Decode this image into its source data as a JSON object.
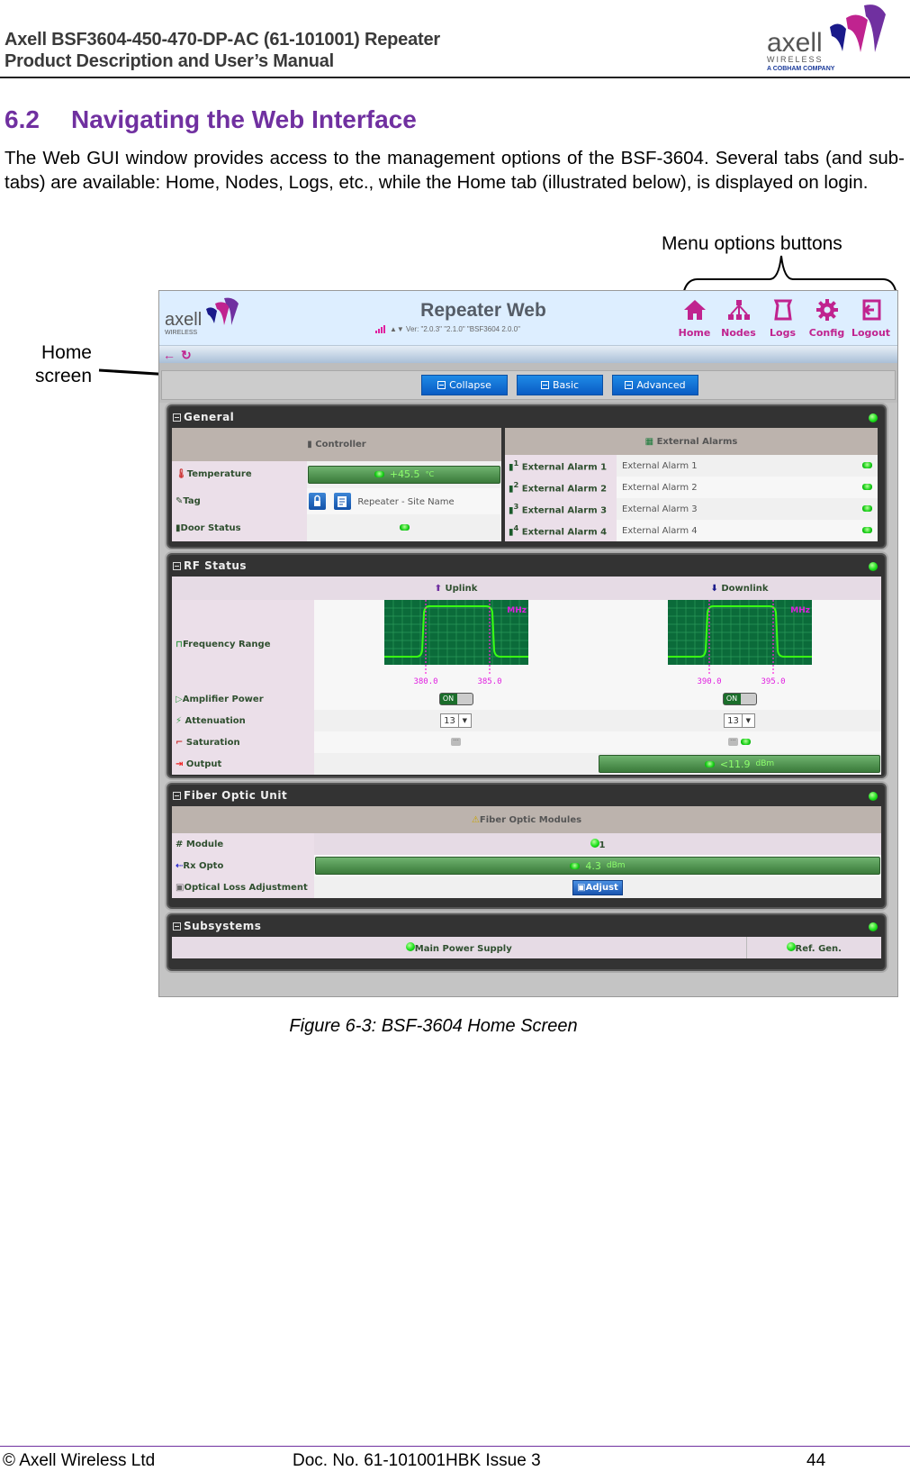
{
  "doc_header": {
    "title_line1": "Axell BSF3604-450-470-DP-AC (61-101001) Repeater",
    "title_line2": "Product Description and User’s Manual",
    "logo_brand": "axell",
    "logo_sub": "WIRELESS",
    "logo_company": "A COBHAM COMPANY"
  },
  "section": {
    "number": "6.2",
    "title": "Navigating the Web Interface",
    "intro": "The Web GUI window provides access to the management options of the BSF-3604. Several tabs (and sub-tabs) are available: Home, Nodes, Logs, etc., while the Home tab (illustrated below), is displayed on login."
  },
  "annotations": {
    "menu_options": "Menu options buttons",
    "home_line1": "Home",
    "home_line2": "screen"
  },
  "app": {
    "logo_brand": "axell",
    "logo_sub": "WIRELESS",
    "title": "Repeater Web",
    "version": "▲▼ Ver: \"2.0.3\" \"2.1.0\" \"BSF3604 2.0.0\"",
    "menu": [
      {
        "label": "Home",
        "icon": "home-icon"
      },
      {
        "label": "Nodes",
        "icon": "nodes-icon"
      },
      {
        "label": "Logs",
        "icon": "logs-icon"
      },
      {
        "label": "Config",
        "icon": "gear-icon"
      },
      {
        "label": "Logout",
        "icon": "logout-icon"
      }
    ],
    "nav": {
      "back_icon": "←",
      "refresh_icon": "↻"
    },
    "mode_buttons": [
      "Collapse",
      "Basic",
      "Advanced"
    ],
    "accent_color": "#c0238f",
    "general": {
      "title": "General",
      "controller_header": "Controller",
      "rows": [
        {
          "label": "Temperature",
          "value": "+45.5",
          "unit": "°C"
        },
        {
          "label": "Tag",
          "value": "Repeater - Site Name"
        },
        {
          "label": "Door Status",
          "value": ""
        }
      ],
      "alarms_header": "External Alarms",
      "alarms": [
        {
          "label": "External Alarm 1",
          "value": "External Alarm 1",
          "sup": "1"
        },
        {
          "label": "External Alarm 2",
          "value": "External Alarm 2",
          "sup": "2"
        },
        {
          "label": "External Alarm 3",
          "value": "External Alarm 3",
          "sup": "3"
        },
        {
          "label": "External Alarm 4",
          "value": "External Alarm 4",
          "sup": "4"
        }
      ]
    },
    "rf_status": {
      "title": "RF Status",
      "uplink": "Uplink",
      "downlink": "Downlink",
      "rows": {
        "frequency": "Frequency Range",
        "amplifier": "Amplifier Power",
        "attenuation": "Attenuation",
        "saturation": "Saturation",
        "output": "Output"
      },
      "unit": "MHz",
      "uplink_freq": [
        "380.0",
        "385.0"
      ],
      "downlink_freq": [
        "390.0",
        "395.0"
      ],
      "uplink_amp": "ON",
      "downlink_amp": "ON",
      "uplink_atten": "13",
      "downlink_atten": "13",
      "saturation_dots": "···",
      "output_value": "<11.9",
      "output_unit": "dBm"
    },
    "fiber": {
      "title": "Fiber Optic Unit",
      "header": "Fiber Optic Modules",
      "rows": {
        "module": "Module",
        "rx": "Rx Opto",
        "loss": "Optical Loss Adjustment"
      },
      "module_value": "1",
      "rx_value": "4.3",
      "rx_unit": "dBm",
      "adjust_label": "Adjust"
    },
    "subsystems": {
      "title": "Subsystems",
      "items": [
        "Main Power Supply",
        "Ref. Gen."
      ]
    }
  },
  "caption": "Figure 6-3:  BSF-3604 Home Screen",
  "footer": {
    "copyright": "© Axell Wireless Ltd",
    "doc_no": "Doc. No. 61-101001HBK Issue 3",
    "page": "44"
  }
}
